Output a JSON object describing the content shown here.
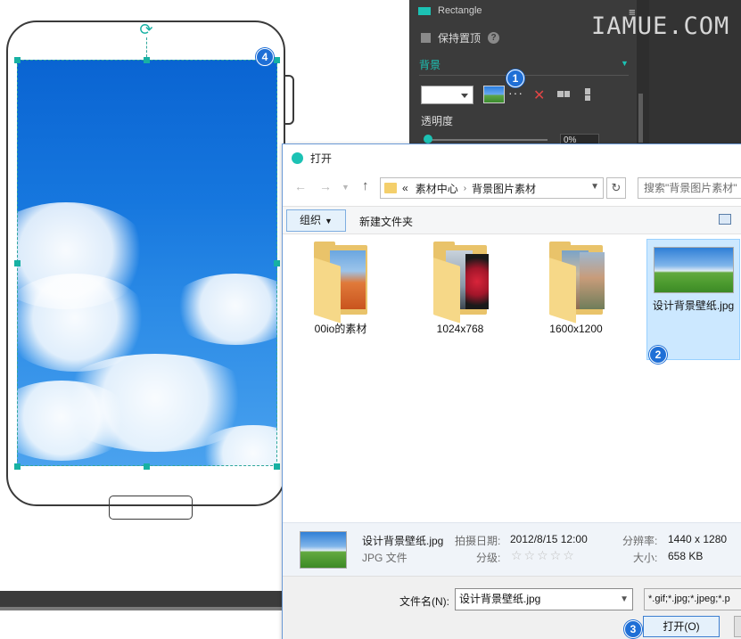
{
  "panel": {
    "title": "Rectangle",
    "lock_aspect_label": "保持置顶",
    "background_section": "背景",
    "more_label": "···",
    "opacity_label": "透明度",
    "opacity_value": "0%",
    "opacity_fraction": 0.0,
    "accent_color": "#1cc2b4"
  },
  "watermark": "IAMUE.COM",
  "annotations": {
    "step1": "1",
    "step2": "2",
    "step3": "3",
    "step4": "4"
  },
  "dialog": {
    "title": "打开",
    "breadcrumb_prefix": "«",
    "breadcrumb": [
      "素材中心",
      "背景图片素材"
    ],
    "search_placeholder": "搜索\"背景图片素材\"",
    "organize_label": "组织",
    "new_folder_label": "新建文件夹",
    "items": [
      {
        "name": "00io的素材",
        "type": "folder"
      },
      {
        "name": "1024x768",
        "type": "folder"
      },
      {
        "name": "1600x1200",
        "type": "folder"
      },
      {
        "name": "设计背景壁纸.jpg",
        "type": "image",
        "selected": true
      }
    ],
    "details": {
      "filename": "设计背景壁纸.jpg",
      "filetype": "JPG 文件",
      "date_label": "拍摄日期:",
      "date_value": "2012/8/15 12:00",
      "rating_label": "分级:",
      "rating_stars": "☆☆☆☆☆",
      "resolution_label": "分辨率:",
      "resolution_value": "1440 x 1280",
      "size_label": "大小:",
      "size_value": "658 KB"
    },
    "filename_label": "文件名(N):",
    "filename_value": "设计背景壁纸.jpg",
    "filter_value": "*.gif;*.jpg;*.jpeg;*.p",
    "open_button": "打开(O)"
  }
}
